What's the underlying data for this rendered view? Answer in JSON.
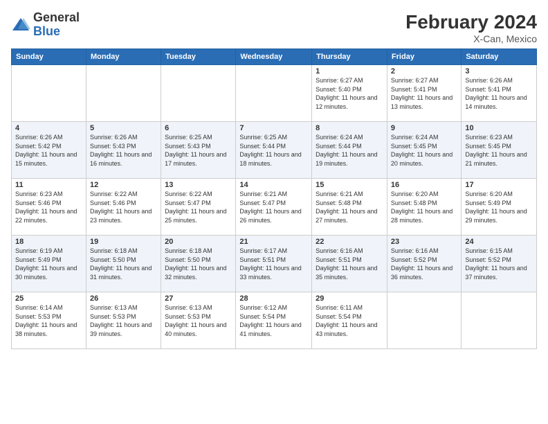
{
  "logo": {
    "general": "General",
    "blue": "Blue"
  },
  "title": {
    "month": "February 2024",
    "location": "X-Can, Mexico"
  },
  "weekdays": [
    "Sunday",
    "Monday",
    "Tuesday",
    "Wednesday",
    "Thursday",
    "Friday",
    "Saturday"
  ],
  "weeks": [
    [
      {
        "day": "",
        "info": ""
      },
      {
        "day": "",
        "info": ""
      },
      {
        "day": "",
        "info": ""
      },
      {
        "day": "",
        "info": ""
      },
      {
        "day": "1",
        "info": "Sunrise: 6:27 AM\nSunset: 5:40 PM\nDaylight: 11 hours and 12 minutes."
      },
      {
        "day": "2",
        "info": "Sunrise: 6:27 AM\nSunset: 5:41 PM\nDaylight: 11 hours and 13 minutes."
      },
      {
        "day": "3",
        "info": "Sunrise: 6:26 AM\nSunset: 5:41 PM\nDaylight: 11 hours and 14 minutes."
      }
    ],
    [
      {
        "day": "4",
        "info": "Sunrise: 6:26 AM\nSunset: 5:42 PM\nDaylight: 11 hours and 15 minutes."
      },
      {
        "day": "5",
        "info": "Sunrise: 6:26 AM\nSunset: 5:43 PM\nDaylight: 11 hours and 16 minutes."
      },
      {
        "day": "6",
        "info": "Sunrise: 6:25 AM\nSunset: 5:43 PM\nDaylight: 11 hours and 17 minutes."
      },
      {
        "day": "7",
        "info": "Sunrise: 6:25 AM\nSunset: 5:44 PM\nDaylight: 11 hours and 18 minutes."
      },
      {
        "day": "8",
        "info": "Sunrise: 6:24 AM\nSunset: 5:44 PM\nDaylight: 11 hours and 19 minutes."
      },
      {
        "day": "9",
        "info": "Sunrise: 6:24 AM\nSunset: 5:45 PM\nDaylight: 11 hours and 20 minutes."
      },
      {
        "day": "10",
        "info": "Sunrise: 6:23 AM\nSunset: 5:45 PM\nDaylight: 11 hours and 21 minutes."
      }
    ],
    [
      {
        "day": "11",
        "info": "Sunrise: 6:23 AM\nSunset: 5:46 PM\nDaylight: 11 hours and 22 minutes."
      },
      {
        "day": "12",
        "info": "Sunrise: 6:22 AM\nSunset: 5:46 PM\nDaylight: 11 hours and 23 minutes."
      },
      {
        "day": "13",
        "info": "Sunrise: 6:22 AM\nSunset: 5:47 PM\nDaylight: 11 hours and 25 minutes."
      },
      {
        "day": "14",
        "info": "Sunrise: 6:21 AM\nSunset: 5:47 PM\nDaylight: 11 hours and 26 minutes."
      },
      {
        "day": "15",
        "info": "Sunrise: 6:21 AM\nSunset: 5:48 PM\nDaylight: 11 hours and 27 minutes."
      },
      {
        "day": "16",
        "info": "Sunrise: 6:20 AM\nSunset: 5:48 PM\nDaylight: 11 hours and 28 minutes."
      },
      {
        "day": "17",
        "info": "Sunrise: 6:20 AM\nSunset: 5:49 PM\nDaylight: 11 hours and 29 minutes."
      }
    ],
    [
      {
        "day": "18",
        "info": "Sunrise: 6:19 AM\nSunset: 5:49 PM\nDaylight: 11 hours and 30 minutes."
      },
      {
        "day": "19",
        "info": "Sunrise: 6:18 AM\nSunset: 5:50 PM\nDaylight: 11 hours and 31 minutes."
      },
      {
        "day": "20",
        "info": "Sunrise: 6:18 AM\nSunset: 5:50 PM\nDaylight: 11 hours and 32 minutes."
      },
      {
        "day": "21",
        "info": "Sunrise: 6:17 AM\nSunset: 5:51 PM\nDaylight: 11 hours and 33 minutes."
      },
      {
        "day": "22",
        "info": "Sunrise: 6:16 AM\nSunset: 5:51 PM\nDaylight: 11 hours and 35 minutes."
      },
      {
        "day": "23",
        "info": "Sunrise: 6:16 AM\nSunset: 5:52 PM\nDaylight: 11 hours and 36 minutes."
      },
      {
        "day": "24",
        "info": "Sunrise: 6:15 AM\nSunset: 5:52 PM\nDaylight: 11 hours and 37 minutes."
      }
    ],
    [
      {
        "day": "25",
        "info": "Sunrise: 6:14 AM\nSunset: 5:53 PM\nDaylight: 11 hours and 38 minutes."
      },
      {
        "day": "26",
        "info": "Sunrise: 6:13 AM\nSunset: 5:53 PM\nDaylight: 11 hours and 39 minutes."
      },
      {
        "day": "27",
        "info": "Sunrise: 6:13 AM\nSunset: 5:53 PM\nDaylight: 11 hours and 40 minutes."
      },
      {
        "day": "28",
        "info": "Sunrise: 6:12 AM\nSunset: 5:54 PM\nDaylight: 11 hours and 41 minutes."
      },
      {
        "day": "29",
        "info": "Sunrise: 6:11 AM\nSunset: 5:54 PM\nDaylight: 11 hours and 43 minutes."
      },
      {
        "day": "",
        "info": ""
      },
      {
        "day": "",
        "info": ""
      }
    ]
  ]
}
